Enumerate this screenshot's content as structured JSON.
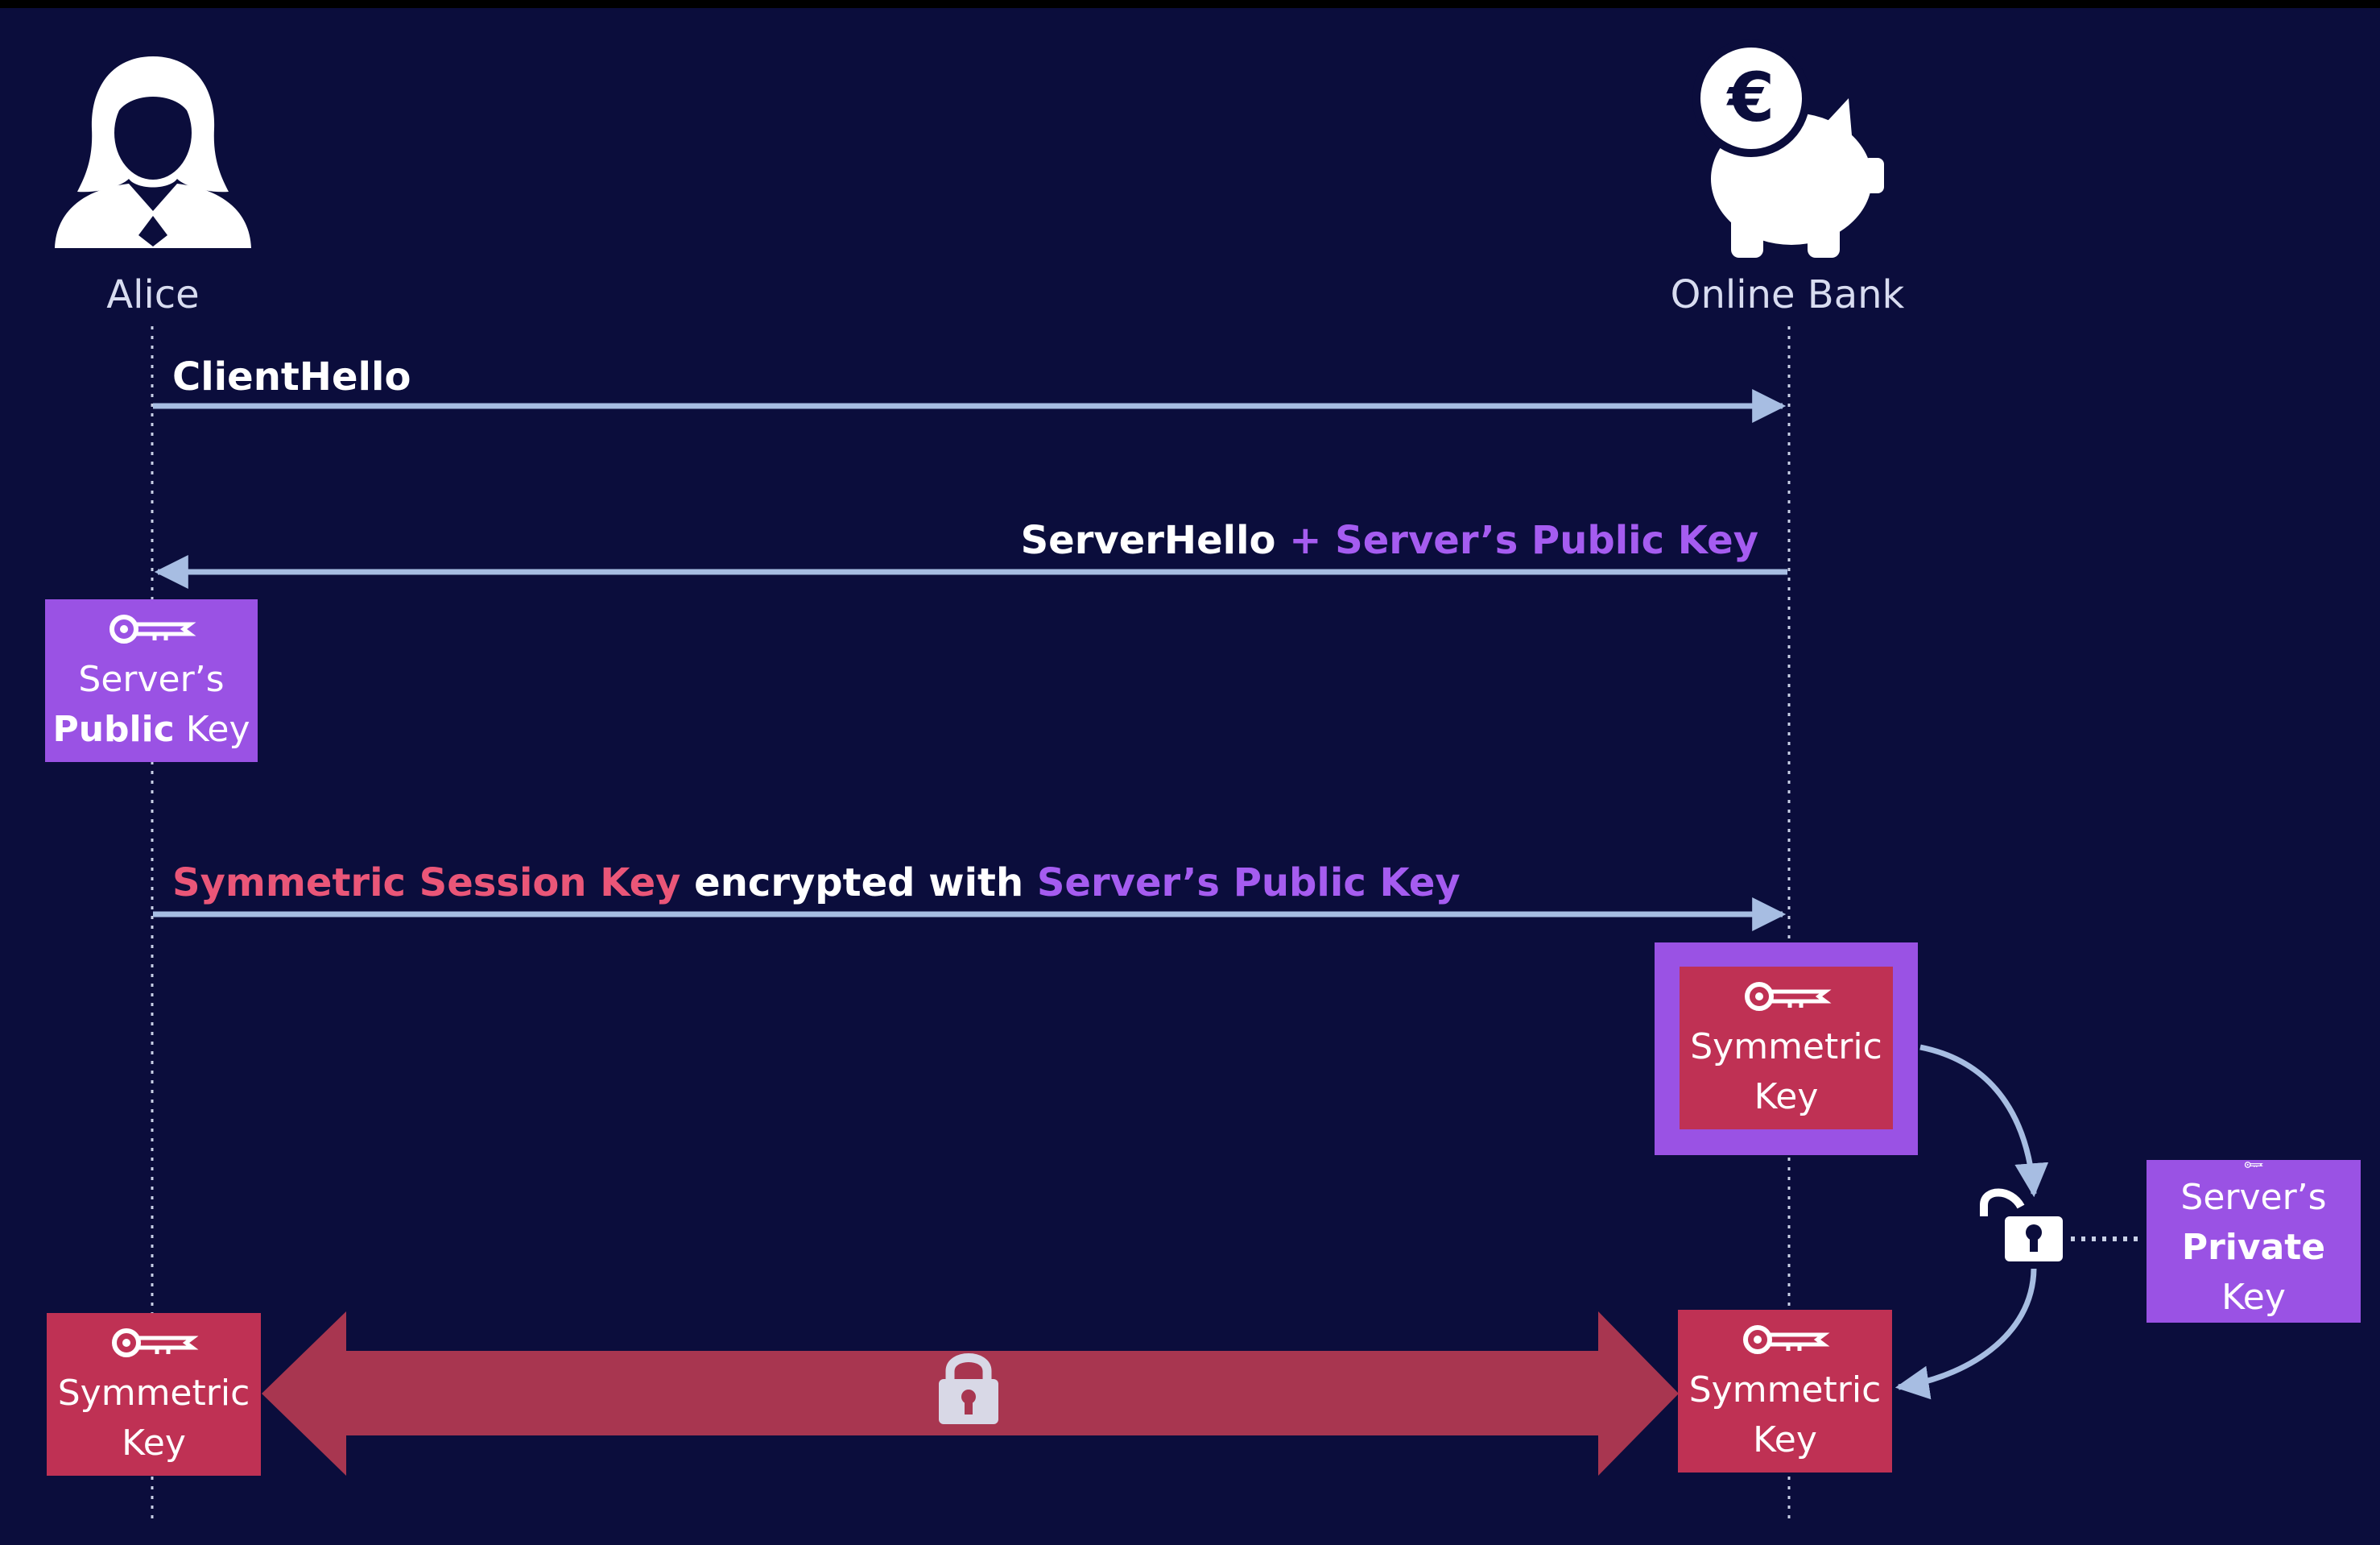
{
  "actors": {
    "alice": {
      "label": "Alice",
      "icon": "user-female-icon"
    },
    "bank": {
      "label": "Online Bank",
      "icon": "piggy-bank-euro-icon"
    }
  },
  "messages": {
    "client_hello": {
      "text": "ClientHello"
    },
    "server_hello": {
      "prefix": "ServerHello",
      "joiner": " + ",
      "key": "Server’s Public Key"
    },
    "session_key": {
      "part1": "Symmetric Session Key",
      "part2": " encrypted with ",
      "part3": "Server’s Public Key"
    }
  },
  "boxes": {
    "alice_public_key": {
      "line1": "Server’s",
      "bold": "Public",
      "rest": " Key"
    },
    "bank_encrypted_sym_key": {
      "line1": "Symmetric",
      "line2": "Key"
    },
    "server_private_key": {
      "line1": "Server’s",
      "bold": "Private",
      "rest": " Key"
    },
    "alice_sym_key": {
      "line1": "Symmetric",
      "line2": "Key"
    },
    "bank_sym_key": {
      "line1": "Symmetric",
      "line2": "Key"
    }
  },
  "icons": [
    "key-icon",
    "padlock-open-icon",
    "padlock-closed-icon",
    "arrow-icon"
  ],
  "colors": {
    "background": "#0b0d3c",
    "purple": "#9a52e4",
    "purple_text": "#a55cf0",
    "red": "#bf3154",
    "pink_text": "#ea5678",
    "arrow": "#a7bde2"
  }
}
